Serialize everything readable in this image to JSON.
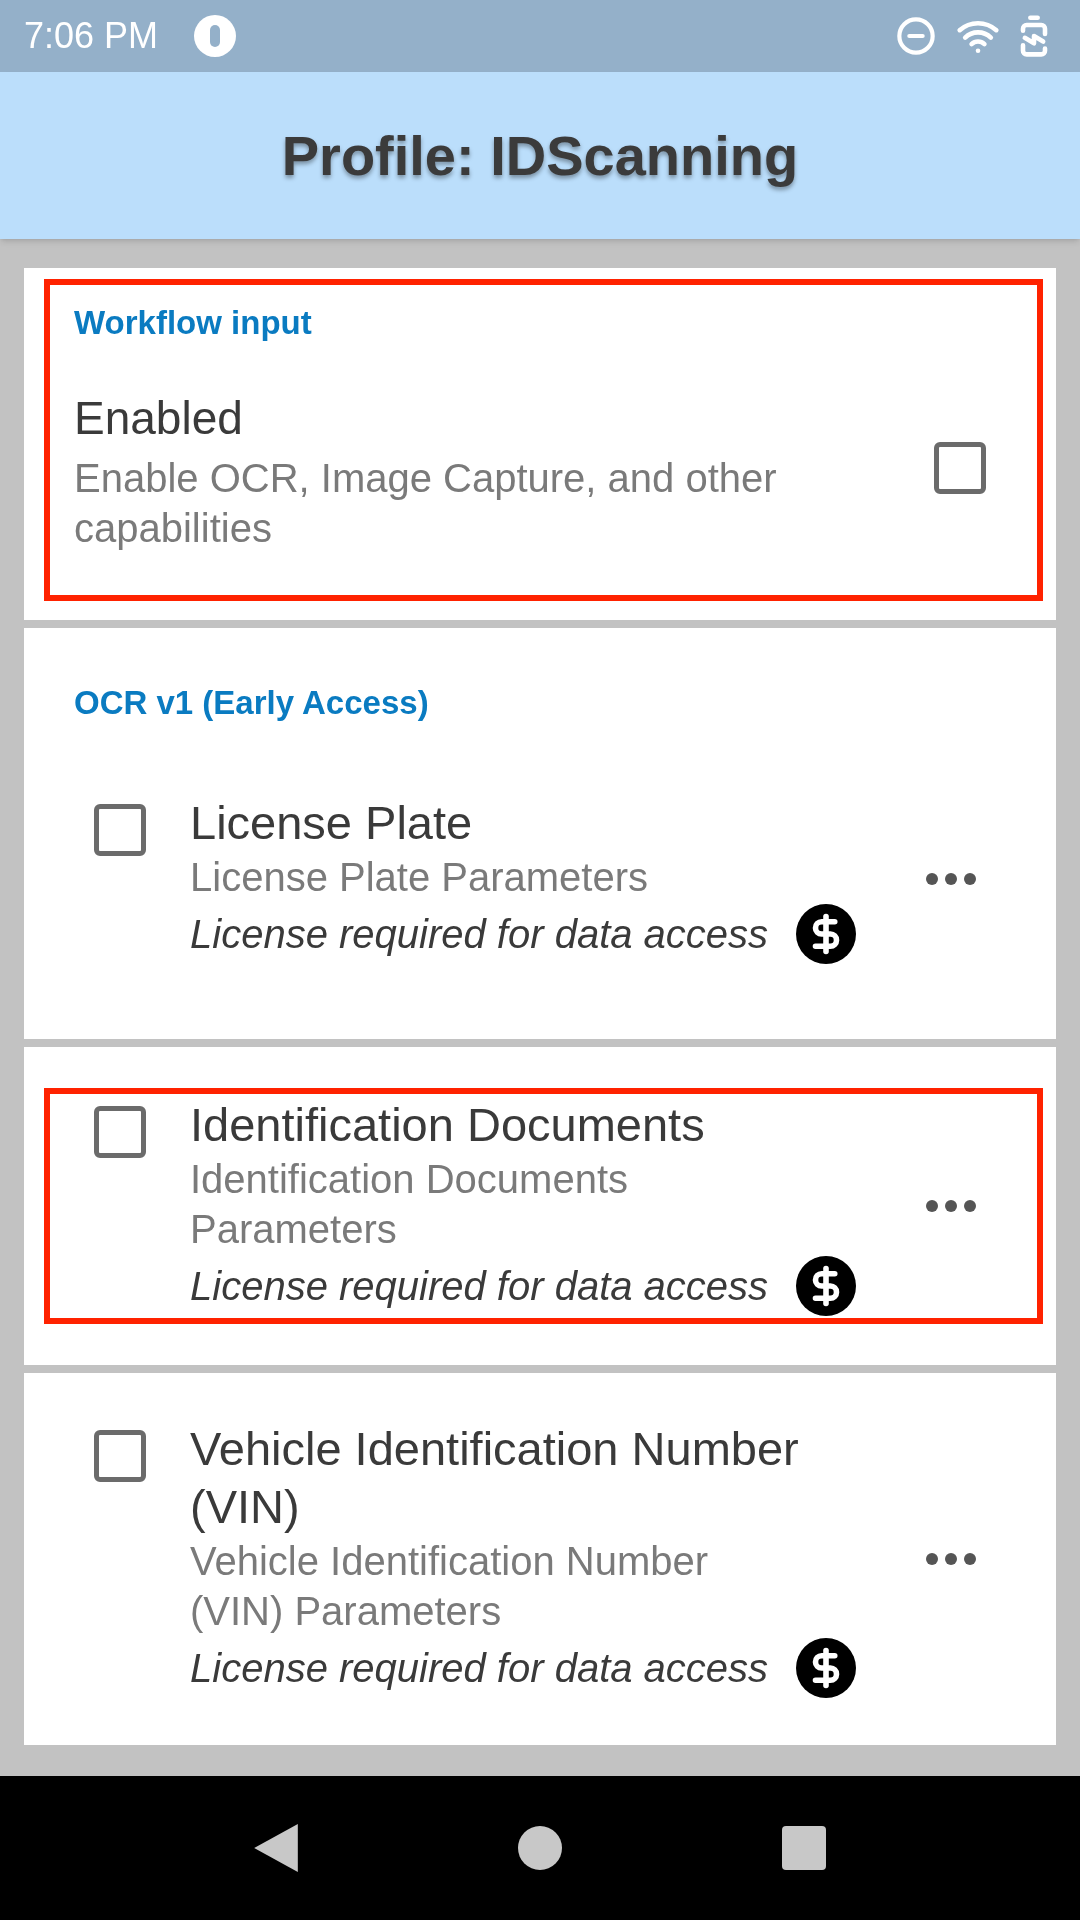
{
  "status_bar": {
    "time": "7:06 PM"
  },
  "header": {
    "title": "Profile: IDScanning"
  },
  "workflow_input": {
    "header": "Workflow input",
    "highlighted": true,
    "title": "Enabled",
    "summary": "Enable OCR, Image Capture, and other capabilities",
    "checked": false
  },
  "ocr": {
    "header": "OCR v1 (Early Access)",
    "items": [
      {
        "title": "License Plate",
        "summary": "License Plate Parameters",
        "note": "License required for data access",
        "checked": false,
        "highlighted": false
      },
      {
        "title": "Identification Documents",
        "summary": "Identification Documents Parameters",
        "note": "License required for data access",
        "checked": false,
        "highlighted": true
      },
      {
        "title": "Vehicle Identification Number (VIN)",
        "summary": "Vehicle Identification Number (VIN) Parameters",
        "note": "License required for data access",
        "checked": false,
        "highlighted": false
      }
    ]
  }
}
